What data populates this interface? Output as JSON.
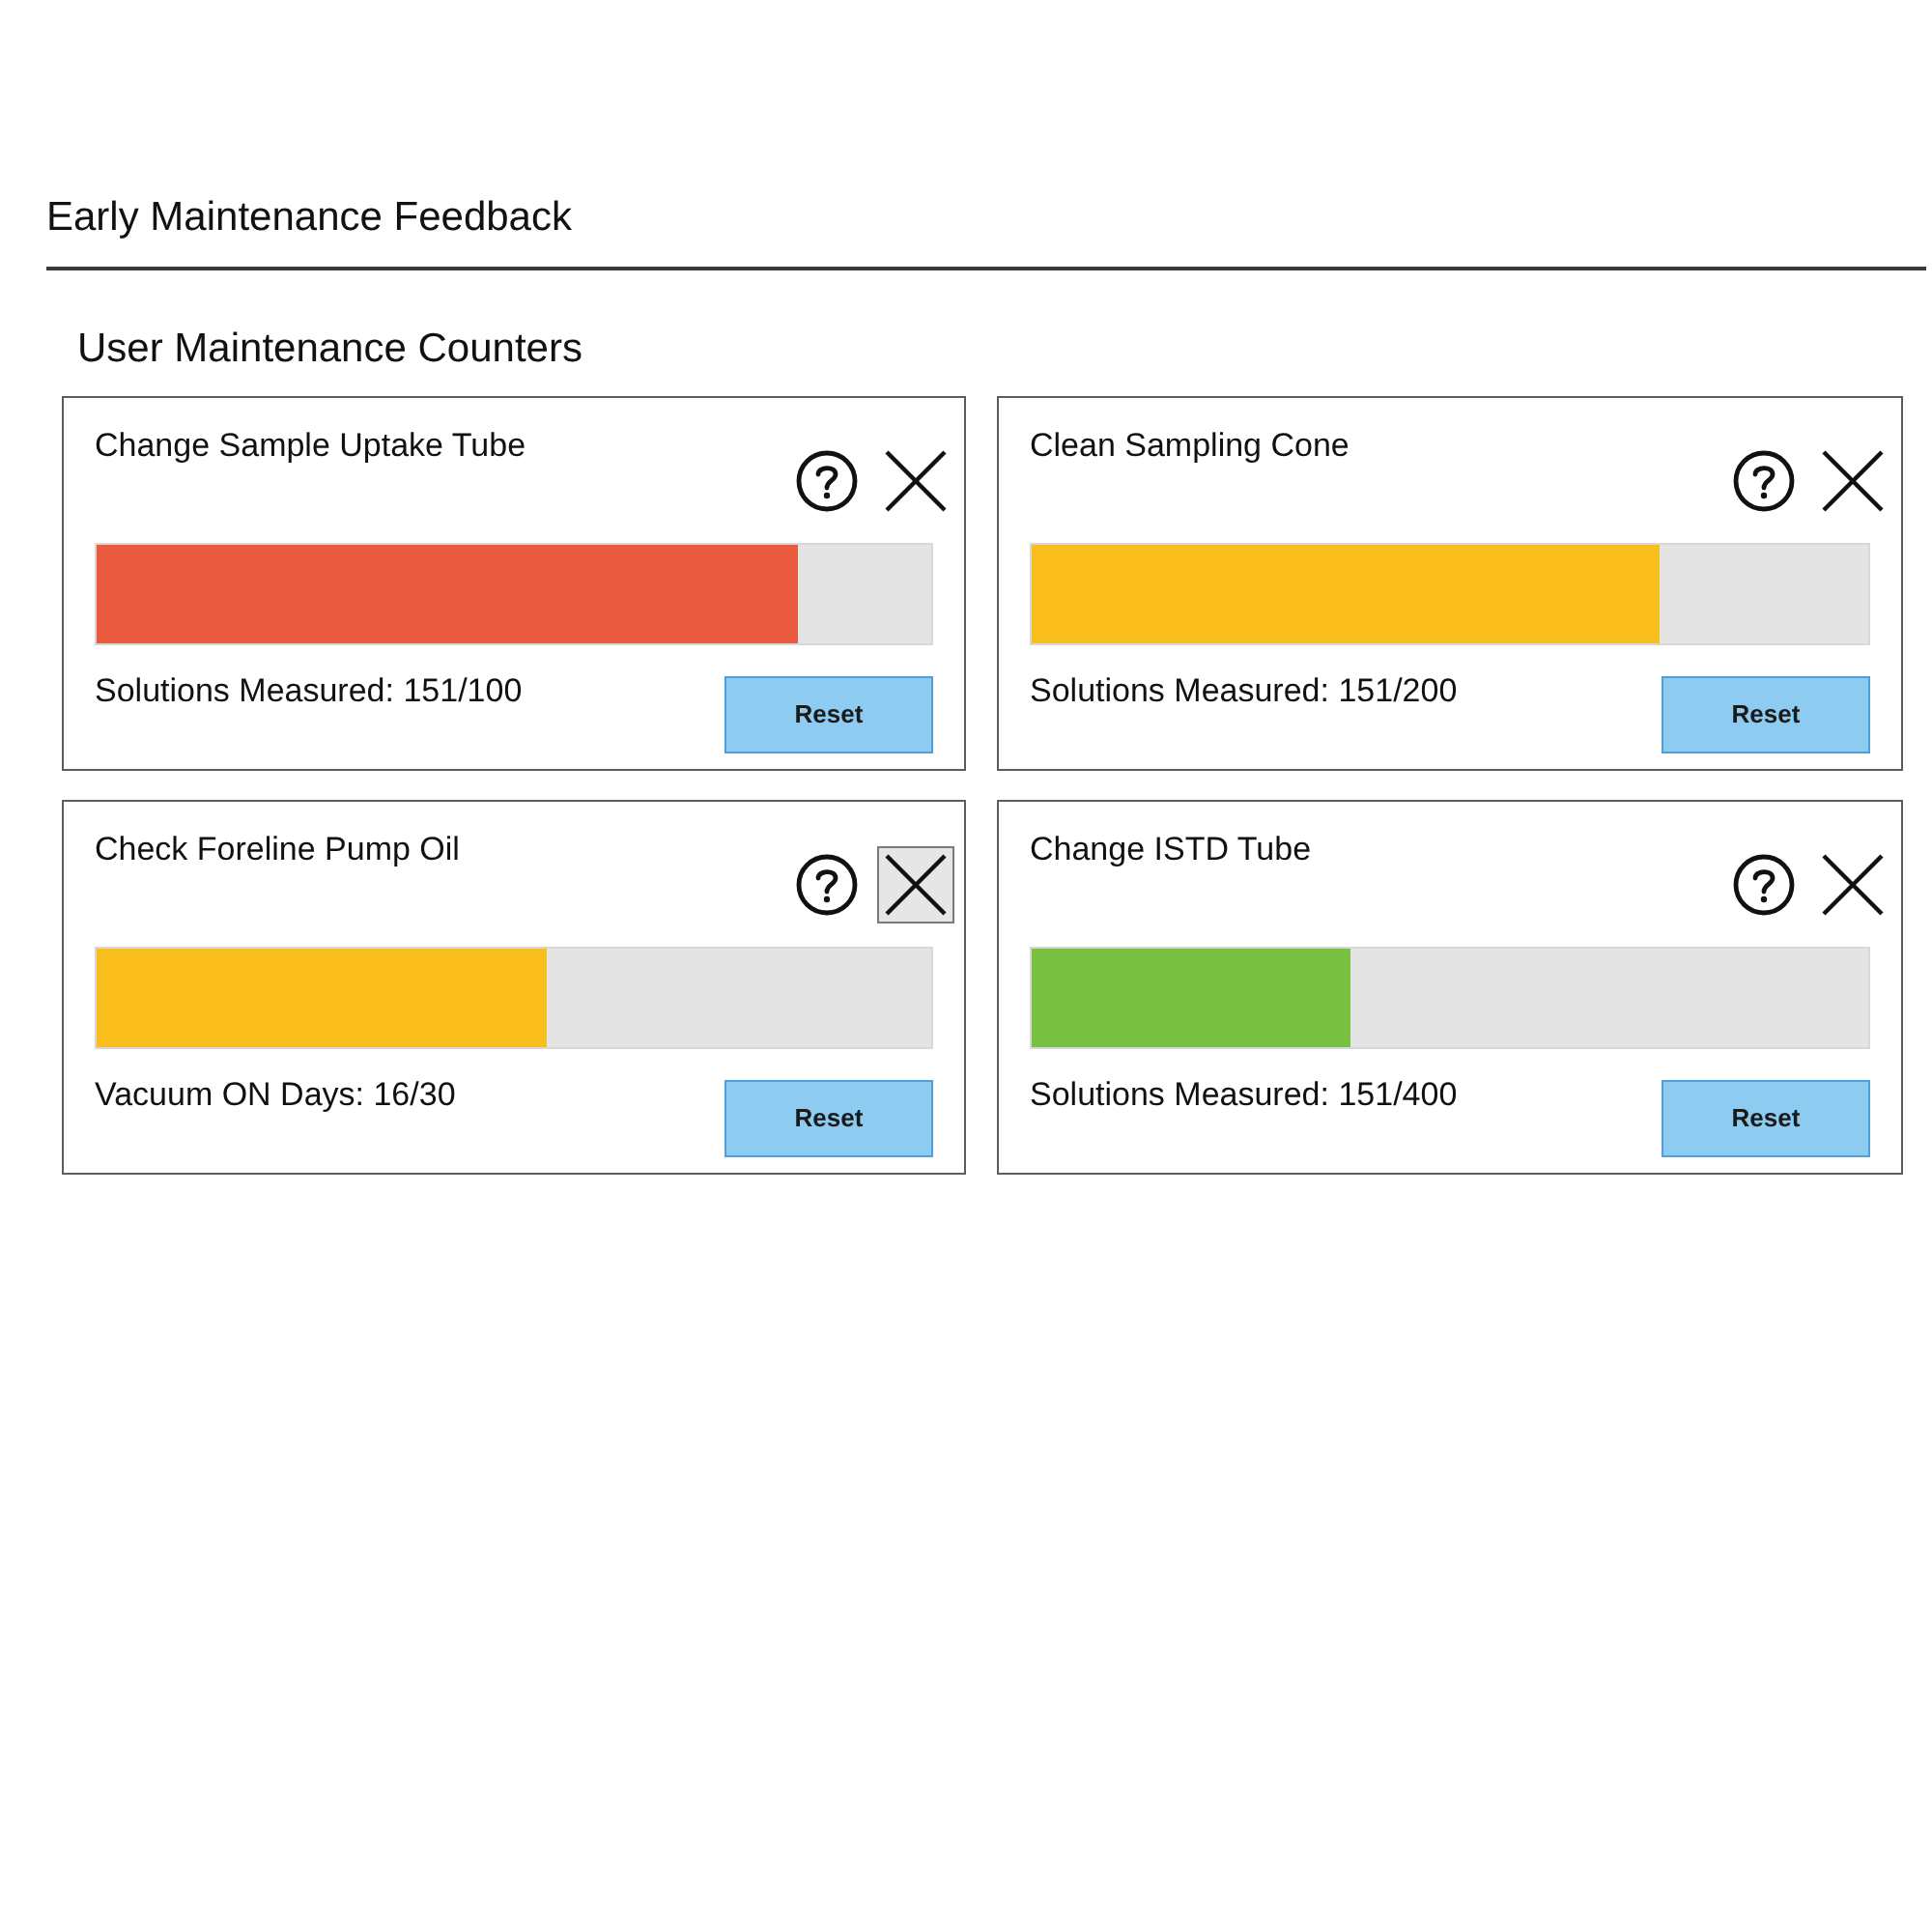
{
  "header": {
    "title": "Early Maintenance Feedback"
  },
  "section": {
    "title": "User Maintenance Counters"
  },
  "cards": [
    {
      "title": "Change Sample Uptake Tube",
      "level": 0.84,
      "color": "#ea5a3f",
      "reading": "Solutions Measured: 151/100",
      "close_hovered": false,
      "button": "Reset"
    },
    {
      "title": "Clean Sampling Cone",
      "level": 0.75,
      "color": "#f9be1c",
      "reading": "Solutions Measured: 151/200",
      "close_hovered": false,
      "button": "Reset"
    },
    {
      "title": "Check Foreline Pump Oil",
      "level": 0.54,
      "color": "#f9be1c",
      "reading": "Vacuum ON Days: 16/30",
      "close_hovered": true,
      "button": "Reset"
    },
    {
      "title": "Change ISTD Tube",
      "level": 0.38,
      "color": "#79c143",
      "reading": "Solutions Measured: 151/400",
      "close_hovered": false,
      "button": "Reset"
    }
  ]
}
